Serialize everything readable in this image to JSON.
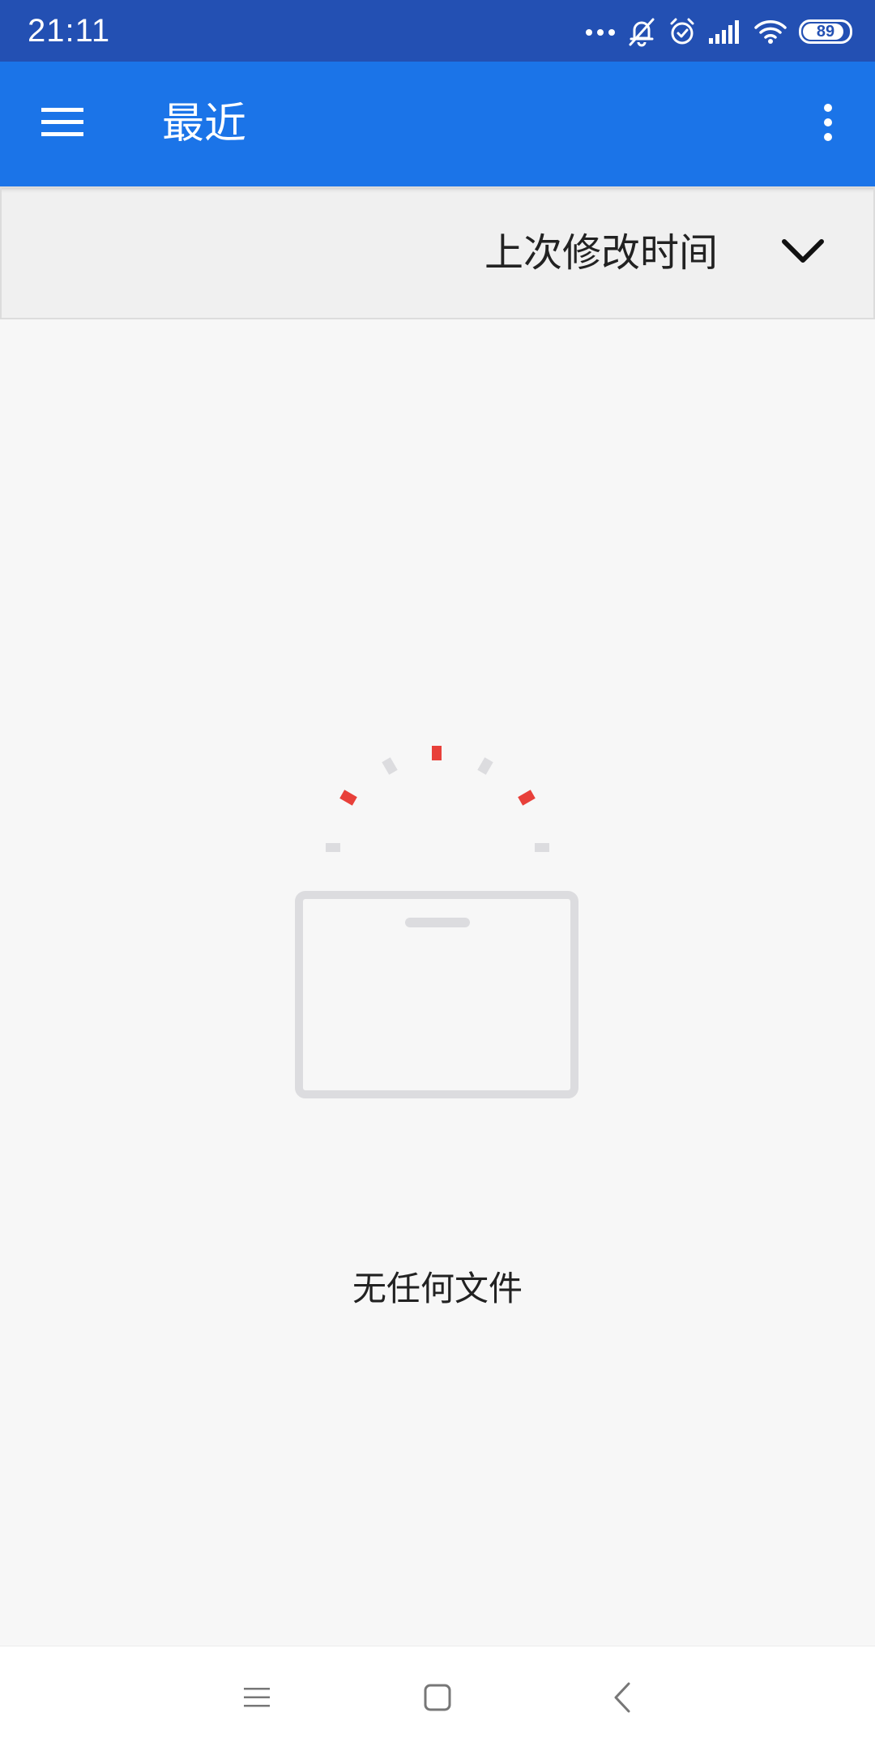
{
  "status_bar": {
    "time": "21:11",
    "battery_level": "89",
    "battery_fraction": 0.89,
    "icons": [
      "more-dots-icon",
      "bell-off-icon",
      "alarm-icon",
      "signal-icon",
      "wifi-icon",
      "battery-icon"
    ]
  },
  "app_bar": {
    "title": "最近",
    "menu_icon": "hamburger-menu-icon",
    "more_icon": "more-vert-icon",
    "background": "#1b74e8"
  },
  "sort_bar": {
    "label": "上次修改时间",
    "dropdown_icon": "chevron-down-icon"
  },
  "empty_state": {
    "message": "无任何文件",
    "illustration_icon": "empty-folder-icon",
    "accent_color": "#e8403a",
    "muted_color": "#dcdcdf"
  },
  "nav_bar": {
    "icons": [
      "recent-apps-icon",
      "home-icon",
      "back-icon"
    ]
  }
}
